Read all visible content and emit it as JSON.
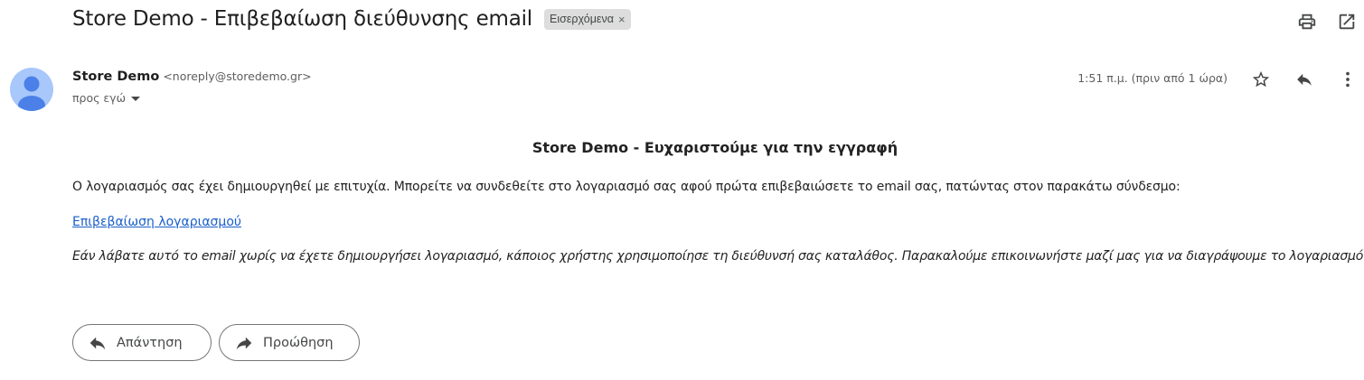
{
  "header": {
    "subject": "Store Demo - Επιβεβαίωση διεύθυνσης email",
    "label_chip": "Εισερχόμενα",
    "label_remove": "×",
    "icons": [
      "print-icon",
      "open-in-new-window-icon"
    ]
  },
  "sender": {
    "name": "Store Demo",
    "email": "<noreply@storedemo.gr>",
    "to": "προς εγώ",
    "timestamp": "1:51 π.μ. (πριν από 1 ώρα)",
    "icons": [
      "star-icon",
      "reply-icon",
      "more-vert-icon"
    ]
  },
  "message": {
    "title": "Store Demo - Ευχαριστούμε για την εγγραφή",
    "body": "Ο λογαριασμός σας έχει δημιουργηθεί με επιτυχία. Μπορείτε να συνδεθείτε στο λογαριασμό σας αφού πρώτα επιβεβαιώσετε το email σας, πατώντας στον παρακάτω σύνδεσμο:",
    "link": "Επιβεβαίωση λογαριασμού",
    "footer_note": "Εάν λάβατε αυτό το email χωρίς να έχετε δημιουργήσει λογαριασμό, κάποιος χρήστης χρησιμοποίησε τη διεύθυνσή σας καταλάθος. Παρακαλούμε επικοινωνήστε μαζί μας για να διαγράψουμε το λογαριασμό."
  },
  "actions": {
    "reply_label": "Απάντηση",
    "forward_label": "Προώθηση"
  },
  "colors": {
    "avatar_bg": "#a8c7fa",
    "avatar_fg": "#4a80e8",
    "link": "#1a5fcb",
    "chip_bg": "#dddddd"
  }
}
